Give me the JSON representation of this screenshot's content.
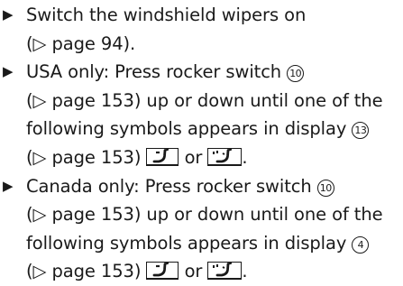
{
  "steps": [
    {
      "bullet": "▶",
      "line1": "Switch the windshield wipers on",
      "line2": "(▷ page 94)."
    },
    {
      "bullet": "▶",
      "line1_pre": "USA only: Press rocker switch",
      "callout_a": "10",
      "line2": "(▷ page 153) up or down until one of the",
      "line3_pre": "following symbols appears in display",
      "callout_b": "13",
      "line4_pre": "(▷ page 153)",
      "or": "or",
      "end": ".",
      "symbol_icons": [
        "rear-wiper-single-icon",
        "rear-wiper-interval-icon"
      ]
    },
    {
      "bullet": "▶",
      "line1_pre": "Canada only: Press rocker switch",
      "callout_a": "10",
      "line2": "(▷ page 153) up or down until one of the",
      "line3_pre": "following symbols appears in display",
      "callout_b": "4",
      "line4_pre": "(▷ page 153)",
      "or": "or",
      "end": ".",
      "symbol_icons": [
        "rear-wiper-single-icon",
        "rear-wiper-interval-icon"
      ]
    }
  ]
}
